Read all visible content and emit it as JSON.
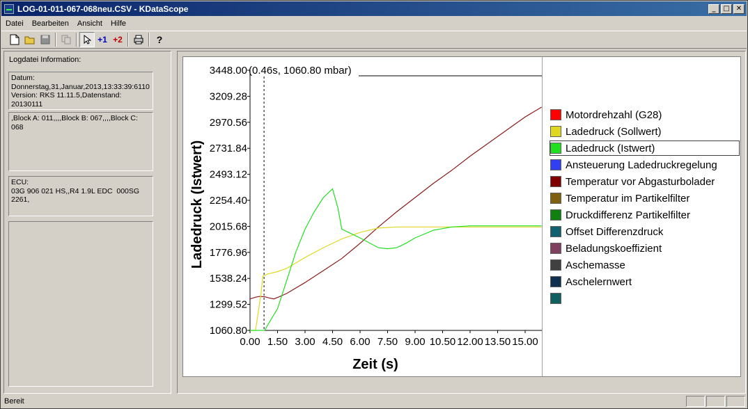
{
  "window": {
    "title": "LOG-01-011-067-068neu.CSV - KDataScope"
  },
  "menu": [
    "Datei",
    "Bearbeiten",
    "Ansicht",
    "Hilfe"
  ],
  "toolbar": {
    "plus1": "+1",
    "plus2": "+2",
    "help": "?"
  },
  "left_panel": {
    "header": "Logdatei Information:",
    "boxes": [
      "Datum:\nDonnerstag,31,Januar,2013,13:33:39:6110\nVersion: RKS 11.11.5,Datenstand:\n20130111",
      ",Block A: 011,,,,Block B: 067,,,,Block C:\n068",
      "ECU:\n03G 906 021 HS,,R4 1.9L EDC  000SG\n2261,",
      ""
    ]
  },
  "status": {
    "text": "Bereit"
  },
  "colors": {
    "motordrehzahl": "#ff0000",
    "ladedruck_soll": "#e0d820",
    "ladedruck_ist": "#20e020",
    "ansteuerung": "#3040f0",
    "temp_abgas": "#800000",
    "temp_partikel": "#806010",
    "druckdifferenz": "#108010",
    "offset": "#106070",
    "beladung": "#804060",
    "asche": "#404040",
    "aschelern": "#103050",
    "extra": "#106060",
    "curve_drehzahl": "#8b1a1a"
  },
  "chart_data": {
    "type": "line",
    "ylabel": "Ladedruck (Istwert)",
    "xlabel": "Zeit (s)",
    "cursor_readout": "(0.46s, 1060.80 mbar)",
    "y_ticks": [
      "3448.00",
      "3209.28",
      "2970.56",
      "2731.84",
      "2493.12",
      "2254.40",
      "2015.68",
      "1776.96",
      "1538.24",
      "1299.52",
      "1060.80"
    ],
    "x_ticks": [
      "0.00",
      "1.50",
      "3.00",
      "4.50",
      "6.00",
      "7.50",
      "9.00",
      "10.50",
      "12.00",
      "13.50",
      "15.00"
    ],
    "ylim": [
      1060.8,
      3448.0
    ],
    "xlim": [
      0.0,
      15.95
    ],
    "cursor_x": 0.46,
    "series_curves": [
      {
        "ref": "motordrehzahl_trace",
        "color": "#8b1a1a",
        "x": [
          0.0,
          0.3,
          0.5,
          0.8,
          1.0,
          1.3,
          1.6,
          2.0,
          3.0,
          4.0,
          5.0,
          6.0,
          7.0,
          8.0,
          9.0,
          10.0,
          11.0,
          12.0,
          13.0,
          14.0,
          15.0,
          15.9
        ],
        "y": [
          1350,
          1365,
          1372,
          1370,
          1360,
          1350,
          1370,
          1400,
          1500,
          1610,
          1720,
          1860,
          2010,
          2150,
          2280,
          2410,
          2530,
          2660,
          2780,
          2900,
          3020,
          3110
        ]
      },
      {
        "ref": "ladedruck_soll_trace",
        "color": "#e0d820",
        "x": [
          0.0,
          0.3,
          0.6,
          0.7,
          1.0,
          1.5,
          2.0,
          2.5,
          3.0,
          4.0,
          5.0,
          6.0,
          7.0,
          8.0,
          10.0,
          12.0,
          14.0,
          15.9
        ],
        "y": [
          1060.8,
          1061,
          1400,
          1560,
          1580,
          1600,
          1630,
          1680,
          1730,
          1820,
          1900,
          1960,
          2000,
          2010,
          2010,
          2010,
          2010,
          2010
        ]
      },
      {
        "ref": "ladedruck_ist_trace",
        "color": "#20e020",
        "x": [
          0.0,
          0.3,
          0.5,
          0.8,
          1.0,
          1.5,
          2.0,
          2.5,
          3.0,
          3.5,
          4.0,
          4.5,
          4.8,
          5.0,
          5.5,
          6.0,
          7.0,
          7.5,
          8.0,
          8.5,
          9.0,
          10.0,
          11.0,
          12.0,
          13.0,
          14.0,
          15.0,
          15.9
        ],
        "y": [
          1060.8,
          1061,
          1061,
          1062,
          1120,
          1260,
          1520,
          1780,
          1990,
          2150,
          2280,
          2360,
          2180,
          1990,
          1950,
          1910,
          1820,
          1810,
          1820,
          1860,
          1910,
          1980,
          2010,
          2020,
          2020,
          2020,
          2020,
          2020
        ]
      }
    ],
    "legend": [
      {
        "name": "Motordrehzahl (G28)",
        "color": "#ff0000"
      },
      {
        "name": "Ladedruck (Sollwert)",
        "color": "#e0d820"
      },
      {
        "name": "Ladedruck (Istwert)",
        "color": "#20e020"
      },
      {
        "name": "Ansteuerung Ladedruckregelung",
        "color": "#3040f0"
      },
      {
        "name": "Temperatur vor Abgasturbolader",
        "color": "#800000"
      },
      {
        "name": "Temperatur im Partikelfilter",
        "color": "#806010"
      },
      {
        "name": "Druckdifferenz Partikelfilter",
        "color": "#108010"
      },
      {
        "name": "Offset Differenzdruck",
        "color": "#106070"
      },
      {
        "name": "Beladungskoeffizient",
        "color": "#804060"
      },
      {
        "name": "Aschemasse",
        "color": "#404040"
      },
      {
        "name": "Aschelernwert",
        "color": "#103050"
      },
      {
        "name": "",
        "color": "#106060"
      }
    ],
    "selected_legend_index": 2
  }
}
